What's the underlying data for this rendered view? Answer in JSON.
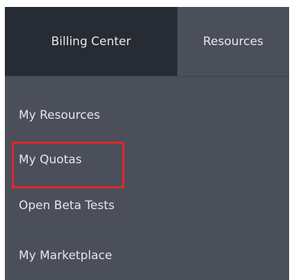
{
  "topnav": {
    "tabs": [
      {
        "label": "Billing Center"
      },
      {
        "label": "Resources"
      }
    ]
  },
  "dropdown": {
    "items": [
      {
        "label": "My Resources"
      },
      {
        "label": "My Quotas",
        "highlighted": true
      },
      {
        "label": "Open Beta Tests"
      },
      {
        "label": "My Marketplace"
      }
    ]
  },
  "colors": {
    "active_tab_bg": "#272b33",
    "menu_bg": "#4b4f5a",
    "text": "#e6e7ea",
    "highlight_border": "#e0262b"
  }
}
